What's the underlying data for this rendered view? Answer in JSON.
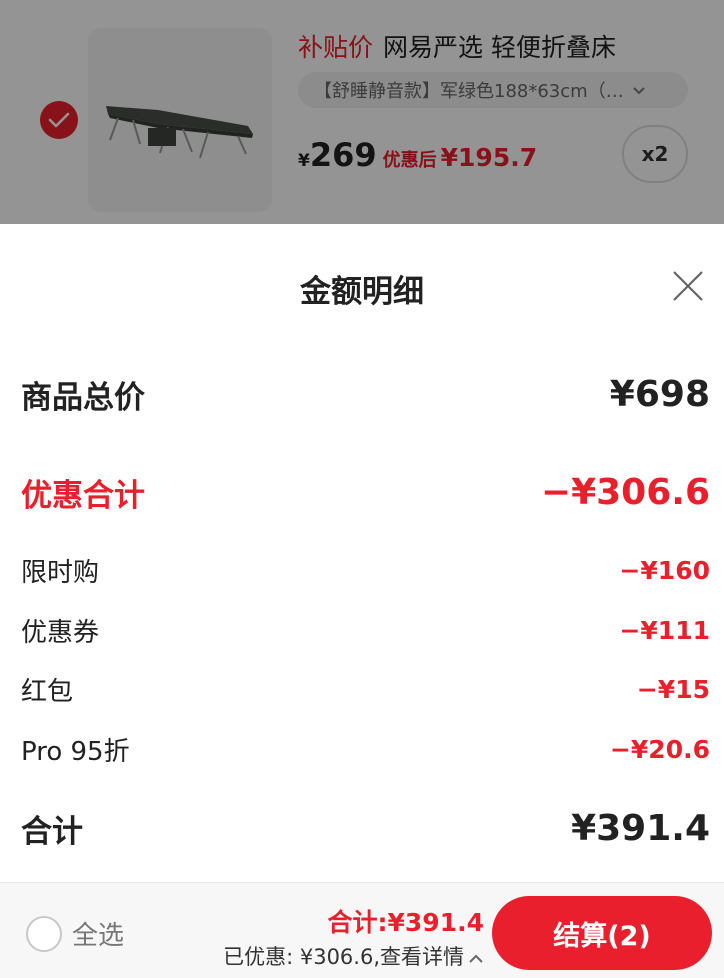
{
  "cart_item": {
    "subsidy_tag": "补贴价",
    "title": "网易严选 轻便折叠床",
    "variant": "【舒睡静音款】军绿色188*63cm（…",
    "currency_symbol": "¥",
    "price": "269",
    "after_discount_label": "优惠后",
    "after_discount_price": "¥195.7",
    "quantity": "x2",
    "selected": true
  },
  "sheet": {
    "title": "金额明细",
    "goods_total_label": "商品总价",
    "goods_total_value": "¥698",
    "discount_total_label": "优惠合计",
    "discount_total_value": "−¥306.6",
    "discounts": [
      {
        "label": "限时购",
        "value": "−¥160"
      },
      {
        "label": "优惠券",
        "value": "−¥111"
      },
      {
        "label": "红包",
        "value": "−¥15"
      },
      {
        "label": "Pro 95折",
        "value": "−¥20.6"
      }
    ],
    "sum_label": "合计",
    "sum_value": "¥391.4"
  },
  "bottom_bar": {
    "select_all_label": "全选",
    "total_text": "合计:¥391.4",
    "saved_text": "已优惠: ¥306.6,查看详情",
    "checkout_label": "结算(2)"
  },
  "colors": {
    "accent_red": "#e8202c",
    "checkout_red": "#ea1f2d"
  }
}
